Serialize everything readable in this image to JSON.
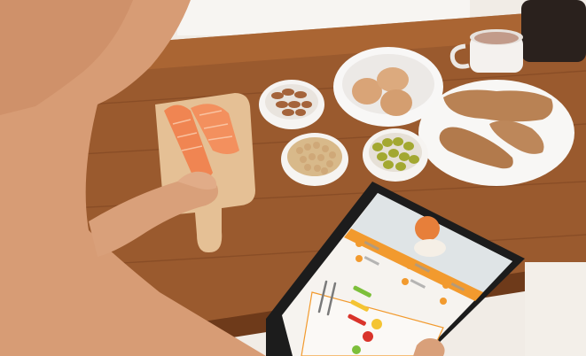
{
  "scene": {
    "description_items": [
      "salmon",
      "almonds",
      "chickpeas",
      "eggs",
      "olives",
      "sweet-potatoes",
      "hot-drink-cup",
      "tablet",
      "hand"
    ]
  },
  "tablet": {
    "app_brand": "",
    "screen_text": ""
  },
  "colors": {
    "table_wood": "#9a5a2e",
    "table_dark": "#6e3a1a",
    "skin": "#d9a07a",
    "salmon": "#f08552",
    "tablet_frame": "#1c1c1c",
    "app_orange": "#f29a2e",
    "app_green": "#7dbf3a",
    "app_red": "#d9342b"
  }
}
